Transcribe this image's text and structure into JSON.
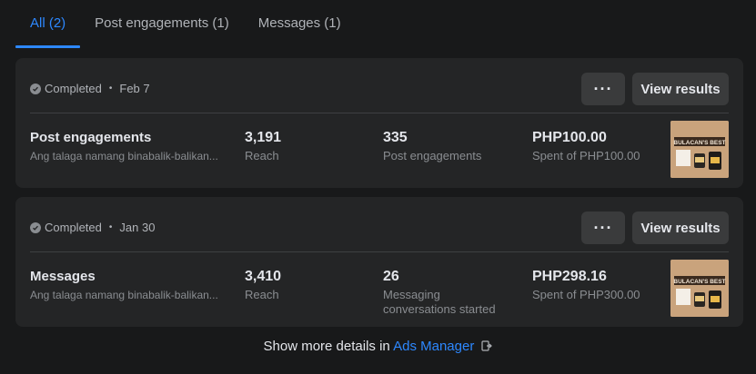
{
  "tabs": [
    {
      "label": "All (2)",
      "active": true
    },
    {
      "label": "Post engagements (1)",
      "active": false
    },
    {
      "label": "Messages (1)",
      "active": false
    }
  ],
  "cards": [
    {
      "status": "Completed",
      "date": "Feb 7",
      "more_label": "···",
      "view_label": "View results",
      "name": "Post engagements",
      "subtitle": "Ang talaga namang binabalik-balikan...",
      "metric1_value": "3,191",
      "metric1_label": "Reach",
      "metric2_value": "335",
      "metric2_label": "Post engagements",
      "spend_value": "PHP100.00",
      "spend_label": "Spent of PHP100.00",
      "thumb_text": "BULACAN'S BEST"
    },
    {
      "status": "Completed",
      "date": "Jan 30",
      "more_label": "···",
      "view_label": "View results",
      "name": "Messages",
      "subtitle": "Ang talaga namang binabalik-balikan...",
      "metric1_value": "3,410",
      "metric1_label": "Reach",
      "metric2_value": "26",
      "metric2_label": "Messaging conversations started",
      "spend_value": "PHP298.16",
      "spend_label": "Spent of PHP300.00",
      "thumb_text": "BULACAN'S BEST"
    }
  ],
  "footer": {
    "prefix": "Show more details in",
    "link": "Ads Manager"
  },
  "colors": {
    "accent": "#2d88ff",
    "background": "#18191a",
    "card": "#242526"
  }
}
